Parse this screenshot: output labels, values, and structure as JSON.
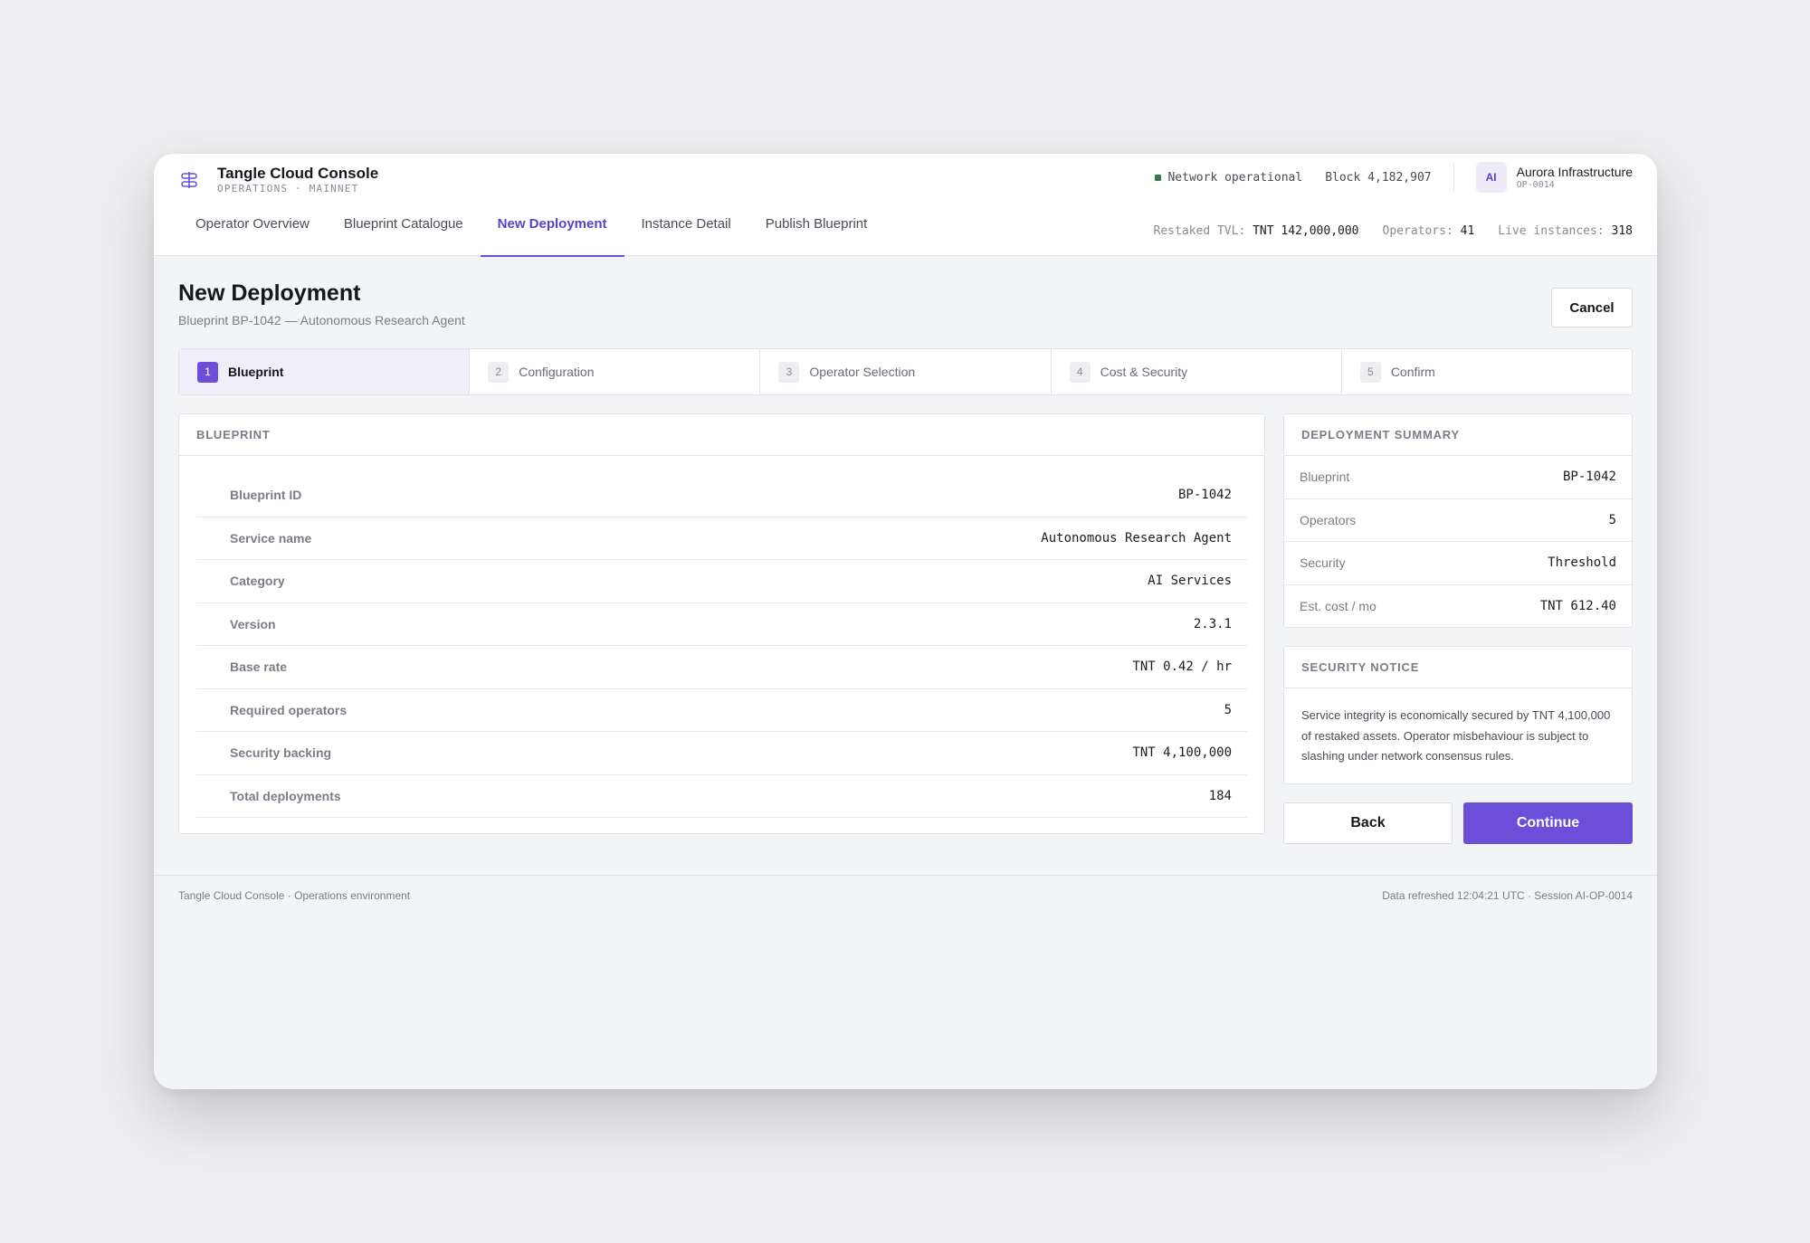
{
  "app": {
    "title": "Tangle Cloud Console",
    "subtitle": "OPERATIONS · MAINNET",
    "icon": "layers-logo-icon",
    "accent_color": "#6b4fd8"
  },
  "status": {
    "network": "Network operational",
    "network_color": "#2e7d4f",
    "block": "Block 4,182,907"
  },
  "account": {
    "initials": "AI",
    "name": "Aurora Infrastructure",
    "id": "OP-0014"
  },
  "nav": {
    "tabs": [
      {
        "label": "Operator Overview",
        "active": false
      },
      {
        "label": "Blueprint Catalogue",
        "active": false
      },
      {
        "label": "New Deployment",
        "active": true
      },
      {
        "label": "Instance Detail",
        "active": false
      },
      {
        "label": "Publish Blueprint",
        "active": false
      }
    ]
  },
  "stats": {
    "tvl_label": "Restaked TVL:",
    "tvl_value": "TNT 142,000,000",
    "operators_label": "Operators:",
    "operators_value": "41",
    "instances_label": "Live instances:",
    "instances_value": "318"
  },
  "page": {
    "title": "New Deployment",
    "subtitle": "Blueprint BP-1042 — Autonomous Research Agent",
    "cancel_label": "Cancel"
  },
  "steps": [
    {
      "num": "1",
      "label": "Blueprint",
      "active": true
    },
    {
      "num": "2",
      "label": "Configuration",
      "active": false
    },
    {
      "num": "3",
      "label": "Operator Selection",
      "active": false
    },
    {
      "num": "4",
      "label": "Cost & Security",
      "active": false
    },
    {
      "num": "5",
      "label": "Confirm",
      "active": false
    }
  ],
  "blueprint": {
    "heading": "BLUEPRINT",
    "rows": [
      {
        "key": "Blueprint ID",
        "value": "BP-1042"
      },
      {
        "key": "Service name",
        "value": "Autonomous Research Agent"
      },
      {
        "key": "Category",
        "value": "AI Services"
      },
      {
        "key": "Version",
        "value": "2.3.1"
      },
      {
        "key": "Base rate",
        "value": "TNT 0.42 / hr"
      },
      {
        "key": "Required operators",
        "value": "5"
      },
      {
        "key": "Security backing",
        "value": "TNT 4,100,000"
      },
      {
        "key": "Total deployments",
        "value": "184"
      }
    ]
  },
  "summary": {
    "heading": "DEPLOYMENT SUMMARY",
    "rows": [
      {
        "key": "Blueprint",
        "value": "BP-1042"
      },
      {
        "key": "Operators",
        "value": "5"
      },
      {
        "key": "Security",
        "value": "Threshold"
      },
      {
        "key": "Est. cost / mo",
        "value": "TNT 612.40"
      }
    ]
  },
  "security_notice": {
    "heading": "SECURITY NOTICE",
    "text": "Service integrity is economically secured by TNT 4,100,000 of restaked assets. Operator misbehaviour is subject to slashing under network consensus rules."
  },
  "actions": {
    "back_label": "Back",
    "continue_label": "Continue"
  },
  "footer": {
    "left": "Tangle Cloud Console · Operations environment",
    "right": "Data refreshed 12:04:21 UTC · Session AI-OP-0014"
  }
}
